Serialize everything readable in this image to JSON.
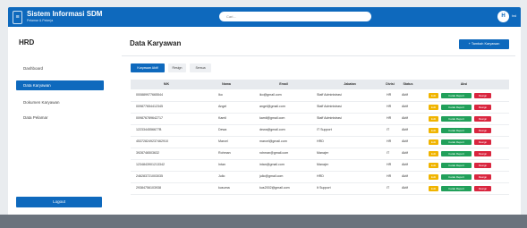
{
  "header": {
    "app_title": "Sistem Informasi SDM",
    "app_subtitle": "Pelamar & Pekerja",
    "search_placeholder": "Cari...",
    "avatar_initial": "H",
    "user_label": "hrd"
  },
  "sidebar": {
    "title": "HRD",
    "items": [
      {
        "label": "Dashboard"
      },
      {
        "label": "Data Karyawan"
      },
      {
        "label": "Dokumen Karyawan"
      },
      {
        "label": "Data Pelamar"
      }
    ],
    "logout_label": "Logout"
  },
  "main": {
    "title": "Data Karyawan",
    "add_button": "+ Tambah Karyawan",
    "tabs": [
      {
        "label": "Karyawan Aktif"
      },
      {
        "label": "Resign"
      },
      {
        "label": "Semua"
      }
    ],
    "columns": [
      "NIK",
      "Nama",
      "Email",
      "Jabatan",
      "Divisi",
      "Status",
      "Aksi"
    ],
    "actions": {
      "edit": "Edit",
      "report": "Cetak Report",
      "resign": "Resign"
    },
    "rows": [
      [
        "000889977665544",
        "Iko",
        "iko@gmail.com",
        "Staff Administrasi",
        "HR",
        "Aktif"
      ],
      [
        "009877654412345",
        "Angel",
        "angel@gmail.com",
        "Staff Administrasi",
        "HR",
        "Aktif"
      ],
      [
        "009876789642717",
        "Kamil",
        "kamil@gmail.com",
        "Staff Administrasi",
        "HR",
        "Aktif"
      ],
      [
        "1223344556677B",
        "Dewa",
        "dewa@gmail.com",
        "IT Support",
        "IT",
        "Aktif"
      ],
      [
        "453728249237462910",
        "Marcel",
        "marcel@gmail.com",
        "HRD",
        "HR",
        "Aktif"
      ],
      [
        "3928746503632",
        "Rohman",
        "rohman@gmail.com",
        "Manajer",
        "IT",
        "Aktif"
      ],
      [
        "1234843901213342",
        "Intan",
        "intan@gmail.com",
        "Manajer",
        "HR",
        "Aktif"
      ],
      [
        "246283721003035",
        "Julio",
        "julio@gmail.com",
        "HRD",
        "HR",
        "Aktif"
      ],
      [
        "29384756103938",
        "kusuma",
        "kus2002@gmail.com",
        "It Support",
        "IT",
        "Aktif"
      ]
    ]
  },
  "colors": {
    "primary": "#0e69bd",
    "edit": "#f0b400",
    "report": "#21a05a",
    "resign": "#d9263f"
  }
}
